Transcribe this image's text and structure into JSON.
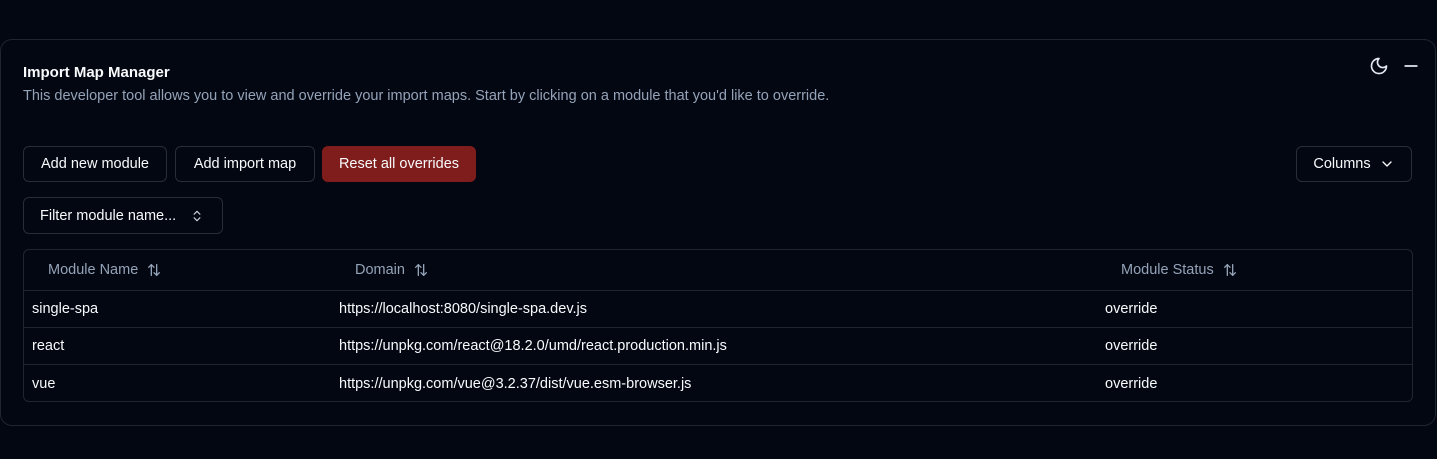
{
  "header": {
    "title": "Import Map Manager",
    "description": "This developer tool allows you to view and override your import maps. Start by clicking on a module that you'd like to override."
  },
  "window_controls": {
    "theme_icon": "moon-icon",
    "minimize_icon": "minus-icon"
  },
  "toolbar": {
    "add_module_label": "Add new module",
    "add_import_map_label": "Add import map",
    "reset_overrides_label": "Reset all overrides",
    "columns_label": "Columns"
  },
  "filter": {
    "label": "Filter module name..."
  },
  "table": {
    "columns": [
      "Module Name",
      "Domain",
      "Module Status"
    ],
    "rows": [
      {
        "name": "single-spa",
        "domain": "https://localhost:8080/single-spa.dev.js",
        "status": "override"
      },
      {
        "name": "react",
        "domain": "https://unpkg.com/react@18.2.0/umd/react.production.min.js",
        "status": "override"
      },
      {
        "name": "vue",
        "domain": "https://unpkg.com/vue@3.2.37/dist/vue.esm-browser.js",
        "status": "override"
      }
    ]
  },
  "colors": {
    "background": "#030712",
    "danger": "#7f1d1d",
    "muted_text": "#94a3b8",
    "border": "#1f2533"
  }
}
